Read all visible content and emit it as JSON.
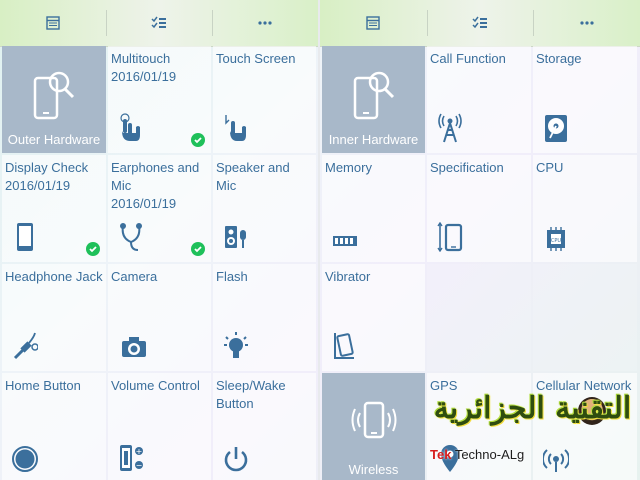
{
  "colors": {
    "icon": "#3b6f9c",
    "title": "#3b6f9c",
    "featured_bg": "#a8b8c9",
    "check": "#1fc05a",
    "topbar": "#d8efc4"
  },
  "left_panel": {
    "tabs": [
      {
        "icon": "calendar-table-icon"
      },
      {
        "icon": "checklist-icon"
      },
      {
        "icon": "more-dots-icon"
      }
    ],
    "tiles": [
      {
        "title": "Outer Hardware",
        "icon": "phone-magnifier-icon",
        "featured": true
      },
      {
        "title": "Multitouch",
        "date": "2016/01/19",
        "icon": "multitouch-icon",
        "checked": true
      },
      {
        "title": "Touch Screen",
        "icon": "touch-icon"
      },
      {
        "title": "Display Check",
        "date": "2016/01/19",
        "icon": "display-phone-icon",
        "checked": true
      },
      {
        "title": "Earphones and Mic",
        "date": "2016/01/19",
        "icon": "earphones-icon",
        "checked": true
      },
      {
        "title": "Speaker and Mic",
        "icon": "speaker-mic-icon"
      },
      {
        "title": "Headphone Jack",
        "icon": "headphone-jack-icon"
      },
      {
        "title": "Camera",
        "icon": "camera-icon"
      },
      {
        "title": "Flash",
        "icon": "flash-bulb-icon"
      },
      {
        "title": "Home Button",
        "icon": "home-button-icon"
      },
      {
        "title": "Volume Control",
        "icon": "volume-control-icon"
      },
      {
        "title": "Sleep/Wake Button",
        "icon": "power-icon"
      }
    ]
  },
  "right_panel": {
    "tabs": [
      {
        "icon": "calendar-table-icon"
      },
      {
        "icon": "checklist-icon"
      },
      {
        "icon": "more-dots-icon"
      }
    ],
    "tiles": [
      {
        "title": "Inner Hardware",
        "icon": "phone-magnifier-icon",
        "featured": true
      },
      {
        "title": "Call Function",
        "icon": "antenna-tower-icon"
      },
      {
        "title": "Storage",
        "icon": "hard-disk-icon"
      },
      {
        "title": "Memory",
        "icon": "memory-chip-icon"
      },
      {
        "title": "Specification",
        "icon": "phone-size-icon"
      },
      {
        "title": "CPU",
        "icon": "cpu-icon"
      },
      {
        "title": "Vibrator",
        "icon": "vibrate-phone-icon"
      },
      {
        "title": "",
        "icon": "",
        "empty": true
      },
      {
        "title": "",
        "icon": "",
        "empty": true
      },
      {
        "title": "Wireless",
        "icon": "wireless-phone-icon",
        "featured": true
      },
      {
        "title": "GPS",
        "icon": "gps-pin-icon"
      },
      {
        "title": "Cellular Network",
        "icon": "cellular-signal-icon"
      }
    ]
  },
  "watermark": {
    "arabic_text": "التقنية الجزائرية",
    "brand": "Techno-ALg",
    "brand_prefix": "Tek"
  }
}
